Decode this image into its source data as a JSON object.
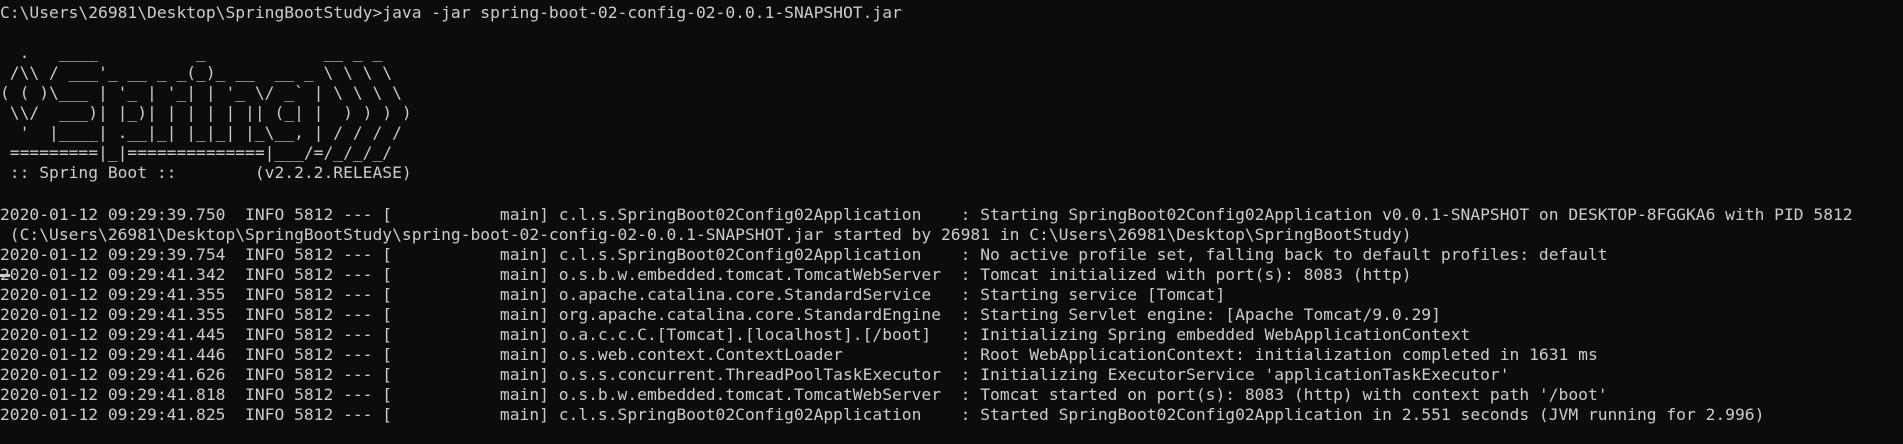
{
  "console": {
    "prompt_line": "C:\\Users\\26981\\Desktop\\SpringBootStudy>java -jar spring-boot-02-config-02-0.0.1-SNAPSHOT.jar",
    "banner": [
      "  .   ____          _            __ _ _",
      " /\\\\ / ___'_ __ _ _(_)_ __  __ _ \\ \\ \\ \\",
      "( ( )\\___ | '_ | '_| | '_ \\/ _` | \\ \\ \\ \\",
      " \\\\/  ___)| |_)| | | | | || (_| |  ) ) ) )",
      "  '  |____| .__|_| |_|_| |_\\__, | / / / /",
      " =========|_|==============|___/=/_/_/_/",
      " :: Spring Boot ::        (v2.2.2.RELEASE)"
    ],
    "log_lines": [
      "2020-01-12 09:29:39.750  INFO 5812 --- [           main] c.l.s.SpringBoot02Config02Application    : Starting SpringBoot02Config02Application v0.0.1-SNAPSHOT on DESKTOP-8FGGKA6 with PID 5812",
      " (C:\\Users\\26981\\Desktop\\SpringBootStudy\\spring-boot-02-config-02-0.0.1-SNAPSHOT.jar started by 26981 in C:\\Users\\26981\\Desktop\\SpringBootStudy)",
      "2020-01-12 09:29:39.754  INFO 5812 --- [           main] c.l.s.SpringBoot02Config02Application    : No active profile set, falling back to default profiles: default",
      "2020-01-12 09:29:41.342  INFO 5812 --- [           main] o.s.b.w.embedded.tomcat.TomcatWebServer  : Tomcat initialized with port(s): 8083 (http)",
      "2020-01-12 09:29:41.355  INFO 5812 --- [           main] o.apache.catalina.core.StandardService   : Starting service [Tomcat]",
      "2020-01-12 09:29:41.355  INFO 5812 --- [           main] org.apache.catalina.core.StandardEngine  : Starting Servlet engine: [Apache Tomcat/9.0.29]",
      "2020-01-12 09:29:41.445  INFO 5812 --- [           main] o.a.c.c.C.[Tomcat].[localhost].[/boot]   : Initializing Spring embedded WebApplicationContext",
      "2020-01-12 09:29:41.446  INFO 5812 --- [           main] o.s.web.context.ContextLoader            : Root WebApplicationContext: initialization completed in 1631 ms",
      "2020-01-12 09:29:41.626  INFO 5812 --- [           main] o.s.s.concurrent.ThreadPoolTaskExecutor  : Initializing ExecutorService 'applicationTaskExecutor'",
      "2020-01-12 09:29:41.818  INFO 5812 --- [           main] o.s.b.w.embedded.tomcat.TomcatWebServer  : Tomcat started on port(s): 8083 (http) with context path '/boot'",
      "2020-01-12 09:29:41.825  INFO 5812 --- [           main] c.l.s.SpringBoot02Config02Application    : Started SpringBoot02Config02Application in 2.551 seconds (JVM running for 2.996)"
    ]
  },
  "colors": {
    "background": "#0c0c0c",
    "text": "#cccccc"
  }
}
